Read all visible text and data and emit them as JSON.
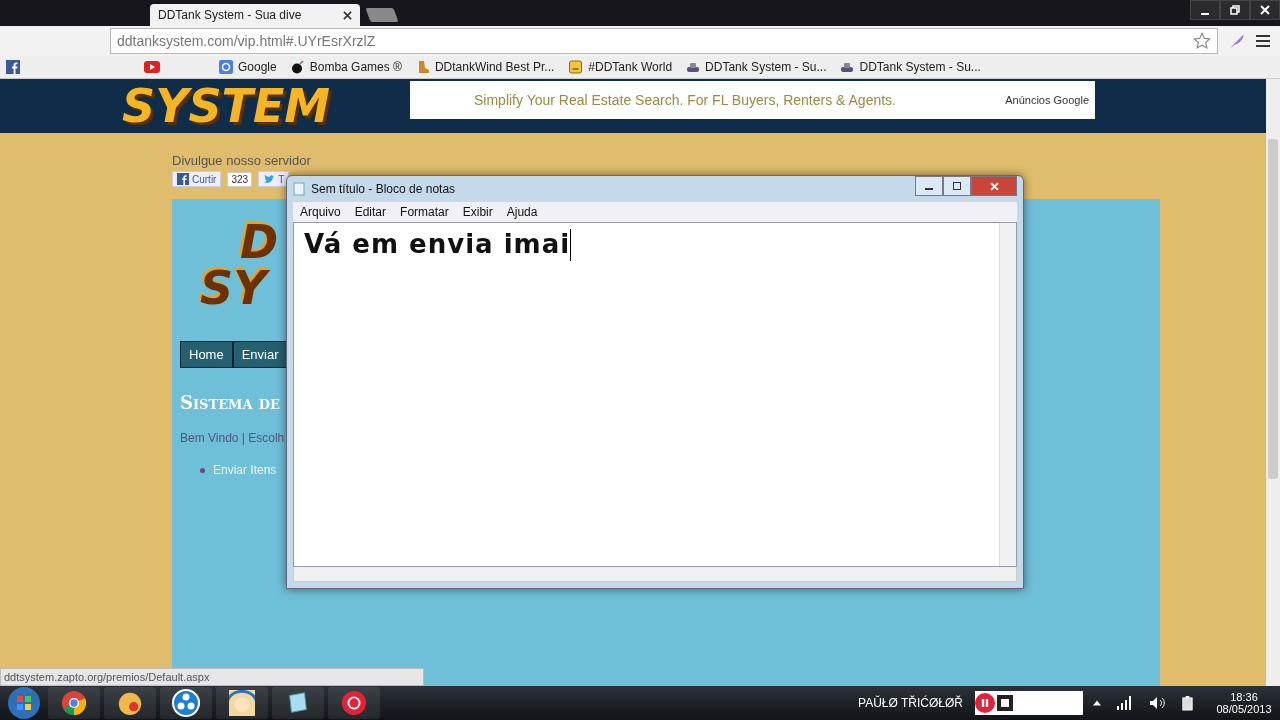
{
  "browser": {
    "tab_title": "DDTank System - Sua dive",
    "url": "ddtanksystem.com/vip.html#.UYrEsrXrzlZ",
    "bookmarks": [
      {
        "kind": "facebook"
      },
      {
        "kind": "youtube"
      },
      {
        "kind": "google",
        "label": "Google"
      },
      {
        "kind": "bomb",
        "label": "Bomba Games ®"
      },
      {
        "kind": "wind",
        "label": "DDtankWind Best Pr..."
      },
      {
        "kind": "world",
        "label": "#DDTank World"
      },
      {
        "kind": "tank",
        "label": "DDTank System - Su..."
      },
      {
        "kind": "tank",
        "label": "DDTank System - Su..."
      }
    ],
    "status_url": "ddtsystem.zapto.org/premios/Default.aspx"
  },
  "page": {
    "header_logo": "SYSTEM",
    "ad_text": "Simplify Your Real Estate Search. For FL Buyers, Renters & Agents.",
    "ad_label": "Anúncios Google",
    "share_label": "Divulgue nosso servidor",
    "like": "Curtir",
    "like_count": "323",
    "tweet": "T",
    "logo_lines": [
      "D",
      "SY"
    ],
    "nav": [
      "Home",
      "Enviar"
    ],
    "heading": "Sistema de",
    "welcome": "Bem Vindo | Escolh",
    "links": [
      "Enviar Itens"
    ]
  },
  "notepad": {
    "title": "Sem título - Bloco de notas",
    "menu": [
      "Arquivo",
      "Editar",
      "Formatar",
      "Exibir",
      "Ajuda"
    ],
    "text": "Vá em envia imai"
  },
  "taskbar": {
    "apps": [
      {
        "kind": "chrome"
      },
      {
        "kind": "game"
      },
      {
        "kind": "dots"
      },
      {
        "kind": "avatar"
      },
      {
        "kind": "notepad"
      },
      {
        "kind": "record"
      }
    ],
    "user": "PAŬŁØ TŘIĆØŁØŘ",
    "time": "18:36",
    "date": "08/05/2013"
  }
}
